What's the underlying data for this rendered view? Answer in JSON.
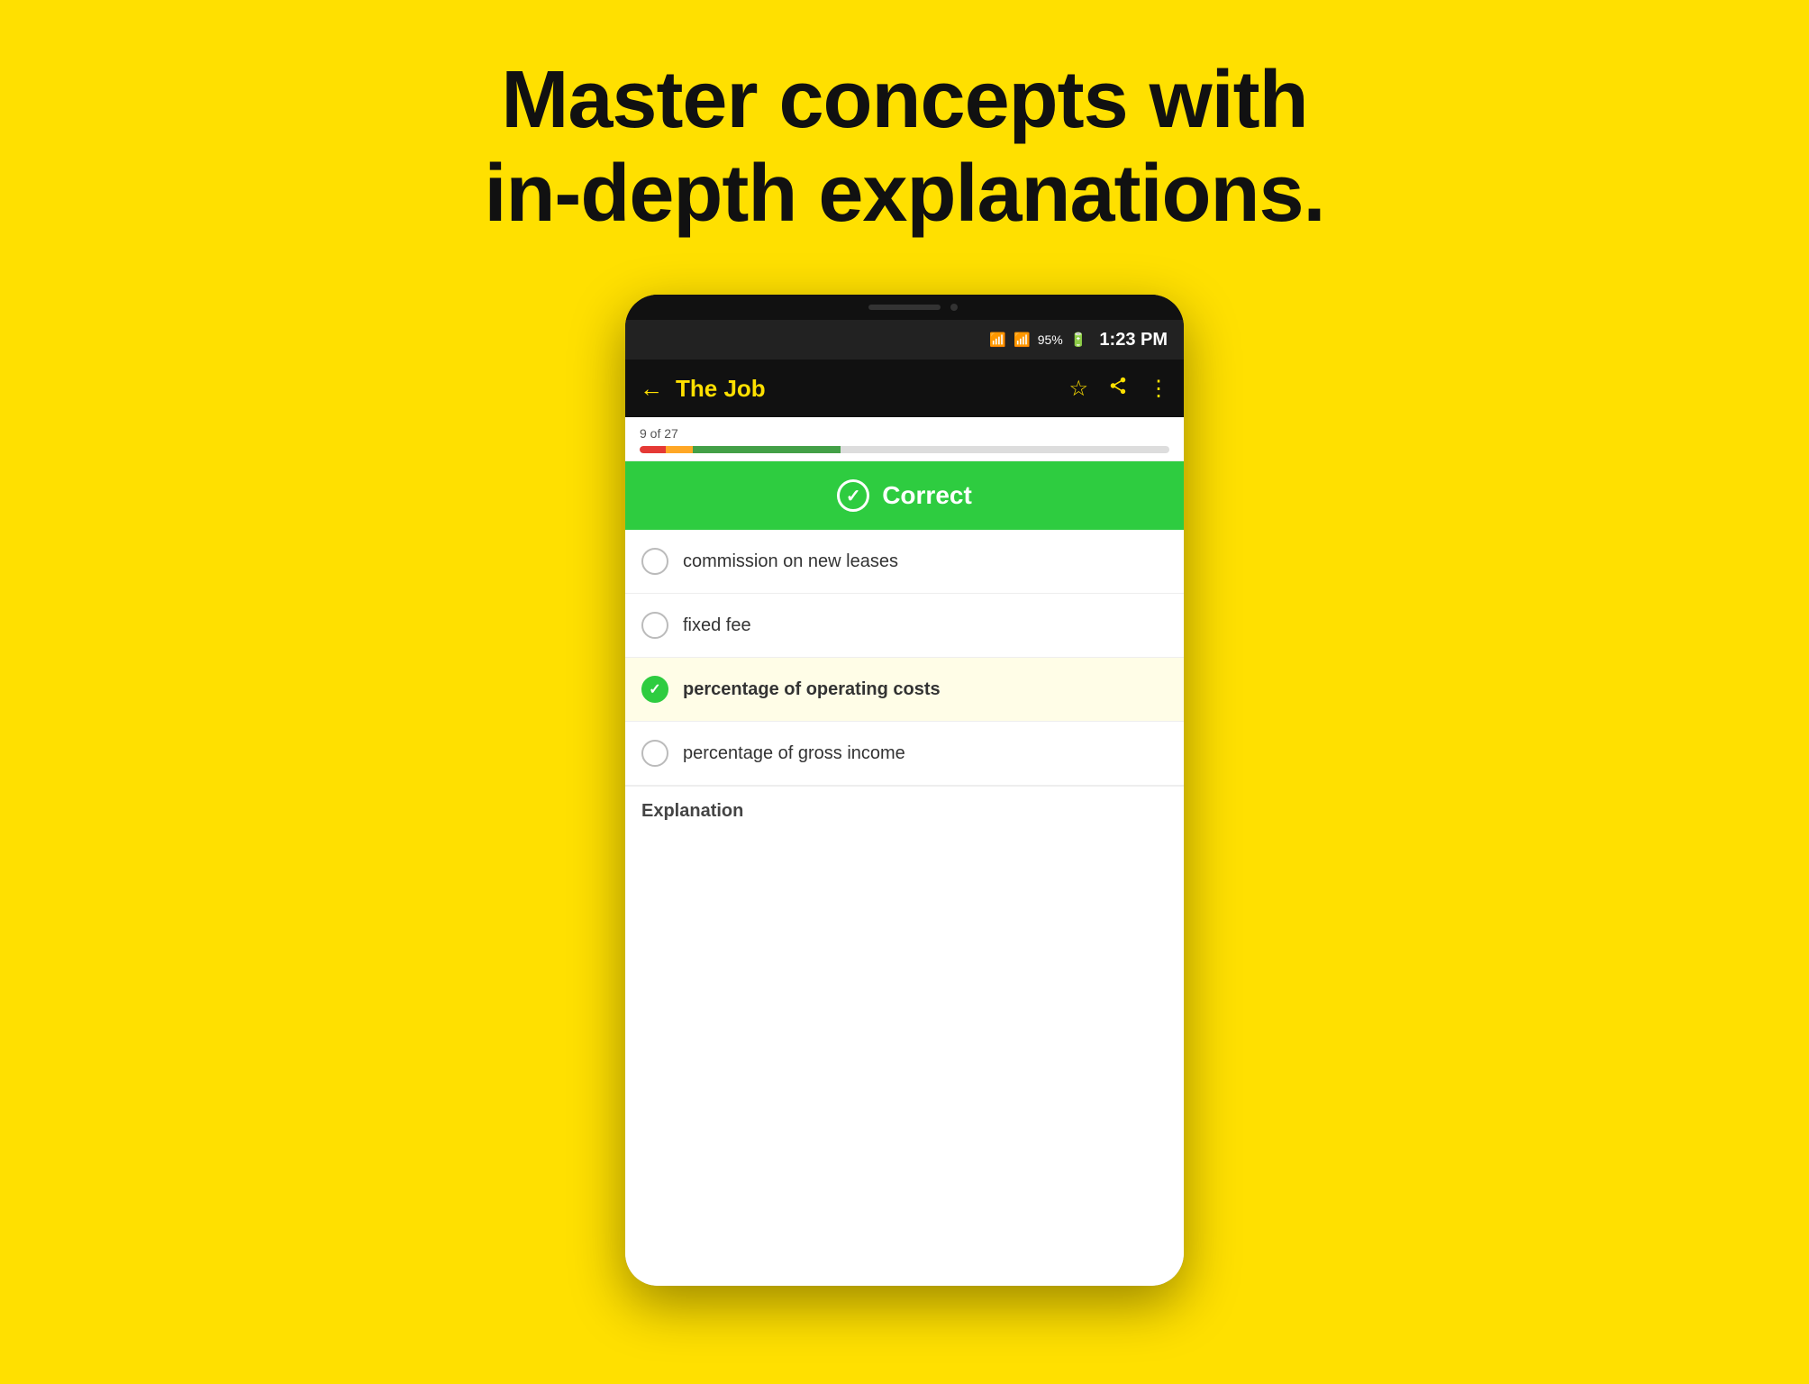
{
  "page": {
    "background_color": "#FFE000",
    "headline_line1": "Master concepts with",
    "headline_line2": "in-depth explanations."
  },
  "status_bar": {
    "time": "1:23 PM",
    "battery": "95%",
    "wifi_icon": "wifi",
    "signal_icon": "signal",
    "battery_icon": "battery"
  },
  "app_bar": {
    "back_label": "←",
    "title": "The Job",
    "star_icon": "☆",
    "share_icon": "⋘",
    "more_icon": "⋮"
  },
  "progress": {
    "label": "9 of 27",
    "red_pct": 5,
    "orange_pct": 5,
    "green_pct": 28
  },
  "correct_banner": {
    "check_symbol": "✓",
    "label": "Correct"
  },
  "options": [
    {
      "id": "opt1",
      "text": "commission on new leases",
      "selected": false,
      "correct": false
    },
    {
      "id": "opt2",
      "text": "fixed fee",
      "selected": false,
      "correct": false
    },
    {
      "id": "opt3",
      "text": "percentage of operating costs",
      "selected": true,
      "correct": true
    },
    {
      "id": "opt4",
      "text": "percentage of gross income",
      "selected": false,
      "correct": false
    }
  ],
  "explanation": {
    "label": "Explanation"
  }
}
